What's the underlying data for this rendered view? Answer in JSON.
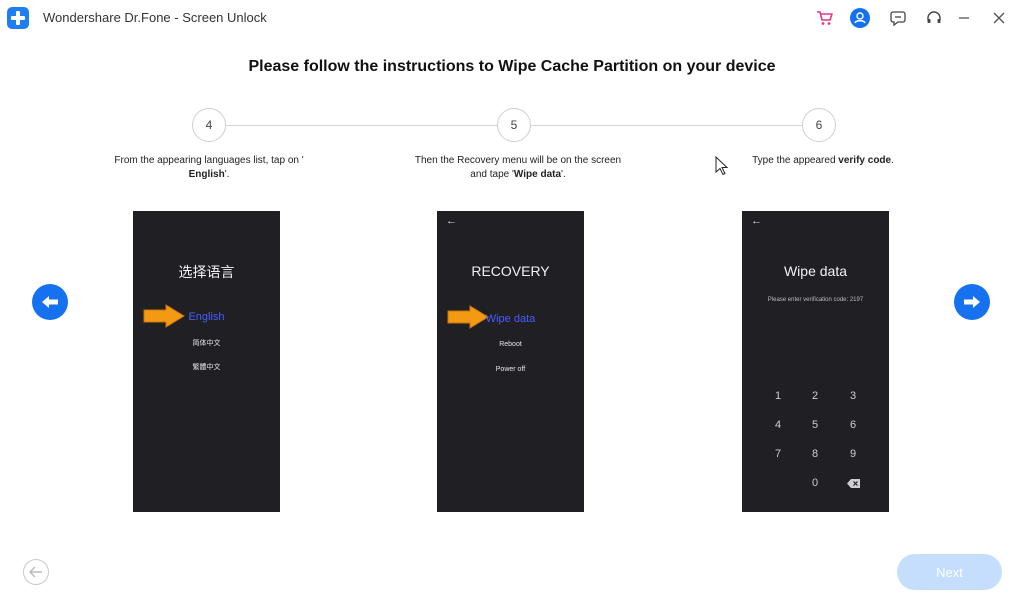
{
  "window": {
    "title": "Wondershare Dr.Fone - Screen Unlock",
    "icons": [
      "shopping-cart-icon",
      "user-avatar-icon",
      "feedback-icon",
      "headset-support-icon",
      "minimize-icon",
      "close-icon"
    ]
  },
  "heading": "Please follow the instructions to Wipe Cache Partition on your device",
  "steps": [
    {
      "number": "4",
      "desc_line1": "From the appearing languages list, tap on '",
      "desc_bold": "English",
      "desc_after": "'.",
      "phone": {
        "title": "选择语言",
        "selected": "English",
        "items": [
          "简体中文",
          "繁體中文"
        ]
      }
    },
    {
      "number": "5",
      "desc_line1": "Then the Recovery menu will be on the screen",
      "desc_pre": "and tape '",
      "desc_bold": "Wipe data",
      "desc_after": "'.",
      "phone": {
        "back": "←",
        "title": "RECOVERY",
        "selected": "Wipe data",
        "items": [
          "Reboot",
          "Power off"
        ]
      }
    },
    {
      "number": "6",
      "desc_pre": "Type the appeared ",
      "desc_bold": "verify code",
      "desc_after": ".",
      "phone": {
        "back": "←",
        "title": "Wipe data",
        "prompt": "Please enter verification code: 2197",
        "keys": [
          "1",
          "2",
          "3",
          "4",
          "5",
          "6",
          "7",
          "8",
          "9",
          "0"
        ]
      }
    }
  ],
  "nav": {
    "prev_icon": "arrow-left-icon",
    "next_icon": "arrow-right-icon"
  },
  "footer": {
    "next_label": "Next"
  },
  "colors": {
    "accent": "#1671f0",
    "phone_bg": "#1f1f24",
    "arrow": "#f39a12",
    "next_disabled": "#c5defd"
  }
}
